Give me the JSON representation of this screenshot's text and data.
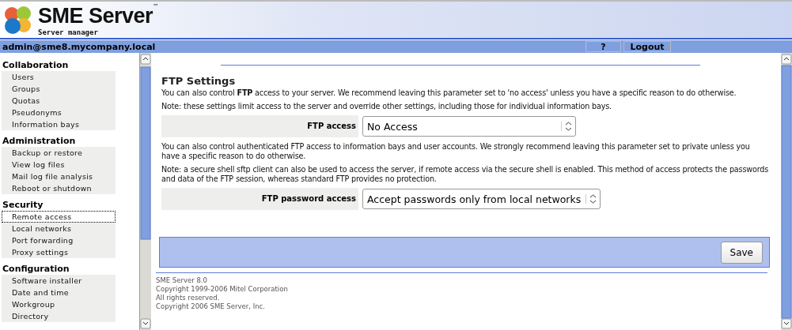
{
  "header": {
    "title": "SME Server",
    "trademark": "™",
    "subtitle": "Server manager"
  },
  "user_bar": {
    "user": "admin@sme8.mycompany.local",
    "buttons": [
      "?",
      "Logout"
    ]
  },
  "sidebar": {
    "sections": [
      {
        "heading": "Collaboration",
        "items": [
          {
            "label": "Users",
            "selected": false
          },
          {
            "label": "Groups",
            "selected": false
          },
          {
            "label": "Quotas",
            "selected": false
          },
          {
            "label": "Pseudonyms",
            "selected": false
          },
          {
            "label": "Information bays",
            "selected": false
          }
        ]
      },
      {
        "heading": "Administration",
        "items": [
          {
            "label": "Backup or restore",
            "selected": false
          },
          {
            "label": "View log files",
            "selected": false
          },
          {
            "label": "Mail log file analysis",
            "selected": false
          },
          {
            "label": "Reboot or shutdown",
            "selected": false
          }
        ]
      },
      {
        "heading": "Security",
        "items": [
          {
            "label": "Remote access",
            "selected": true
          },
          {
            "label": "Local networks",
            "selected": false
          },
          {
            "label": "Port forwarding",
            "selected": false
          },
          {
            "label": "Proxy settings",
            "selected": false
          }
        ]
      },
      {
        "heading": "Configuration",
        "items": [
          {
            "label": "Software installer",
            "selected": false
          },
          {
            "label": "Date and time",
            "selected": false
          },
          {
            "label": "Workgroup",
            "selected": false
          },
          {
            "label": "Directory",
            "selected": false
          }
        ]
      }
    ]
  },
  "content": {
    "title": "FTP Settings",
    "blocks": [
      {
        "kind": "text",
        "text": "You can also control **FTP** access to your server. We recommend leaving this parameter set to 'no access' unless you have a specific reason to do otherwise."
      },
      {
        "kind": "text",
        "text": "Note: these settings limit access to the server and override other settings, including those for individual information bays."
      },
      {
        "kind": "select",
        "label": "FTP access",
        "value": "No Access"
      },
      {
        "kind": "text",
        "text": "You can also control authenticated FTP access to information bays and user accounts. We strongly recommend leaving this parameter set to private unless you have a specific reason to do otherwise."
      },
      {
        "kind": "text",
        "text": "Note: a secure shell sftp client can also be used to access the server, if remote access via the secure shell is enabled. This method of access protects the passwords and data of the FTP session, whereas standard FTP provides no protection."
      },
      {
        "kind": "select",
        "label": "FTP password access",
        "value": "Accept passwords only from local networks"
      }
    ],
    "save_button": "Save"
  },
  "footer": [
    "SME Server 8.0",
    "Copyright 1999-2006 Mitel Corporation",
    "All rights reserved.",
    "Copyright 2006 SME Server, Inc."
  ]
}
